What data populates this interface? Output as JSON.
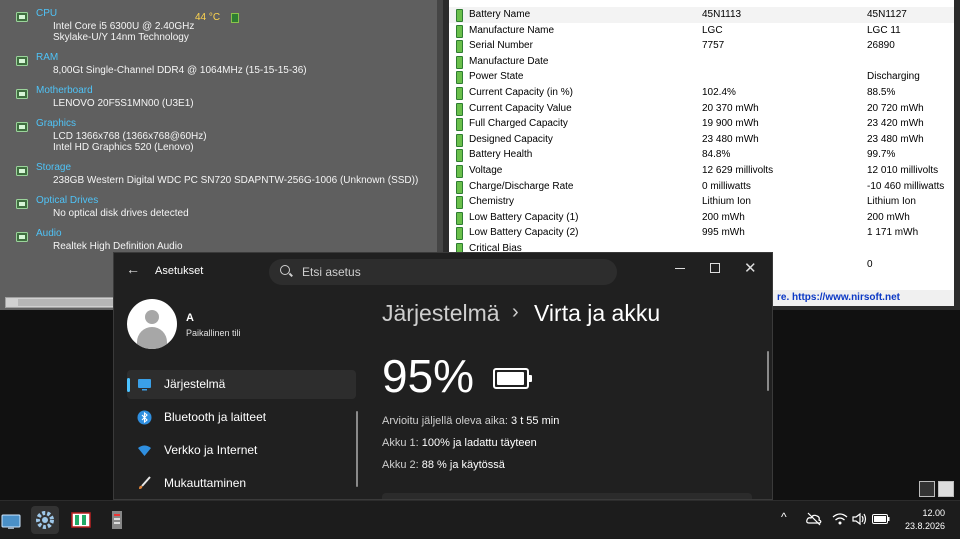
{
  "speccy": {
    "sections": [
      {
        "title": "CPU",
        "lines": [
          "Intel Core i5 6300U @ 2.40GHz",
          "Skylake-U/Y 14nm Technology"
        ],
        "icon": "cpu-icon"
      },
      {
        "title": "RAM",
        "lines": [
          "8,00Gt Single-Channel DDR4 @ 1064MHz (15-15-15-36)"
        ],
        "icon": "ram-icon"
      },
      {
        "title": "Motherboard",
        "lines": [
          "LENOVO 20F5S1MN00 (U3E1)"
        ],
        "icon": "motherboard-icon"
      },
      {
        "title": "Graphics",
        "lines": [
          "LCD 1366x768 (1366x768@60Hz)",
          "Intel HD Graphics 520 (Lenovo)"
        ],
        "icon": "monitor-icon"
      },
      {
        "title": "Storage",
        "lines": [
          "238GB Western Digital WDC PC SN720 SDAPNTW-256G-1006 (Unknown (SSD))"
        ],
        "icon": "hdd-icon"
      },
      {
        "title": "Optical Drives",
        "lines": [
          "No optical disk drives detected"
        ],
        "icon": "disc-icon"
      },
      {
        "title": "Audio",
        "lines": [
          "Realtek High Definition Audio"
        ],
        "icon": "audio-icon"
      }
    ],
    "cpu_temp": "44 °C"
  },
  "battery_view": {
    "rows": [
      {
        "name": "Battery Name",
        "b1": "45N1113",
        "b2": "45N1127"
      },
      {
        "name": "Manufacture Name",
        "b1": "LGC",
        "b2": "LGC 11"
      },
      {
        "name": "Serial Number",
        "b1": " 7757",
        "b2": "26890"
      },
      {
        "name": "Manufacture Date",
        "b1": "",
        "b2": ""
      },
      {
        "name": "Power State",
        "b1": "",
        "b2": "Discharging"
      },
      {
        "name": "Current Capacity (in %)",
        "b1": "102.4%",
        "b2": "88.5%"
      },
      {
        "name": "Current Capacity Value",
        "b1": "20 370 mWh",
        "b2": "20 720 mWh"
      },
      {
        "name": "Full Charged Capacity",
        "b1": "19 900 mWh",
        "b2": "23 420 mWh"
      },
      {
        "name": "Designed Capacity",
        "b1": "23 480 mWh",
        "b2": "23 480 mWh"
      },
      {
        "name": "Battery Health",
        "b1": "84.8%",
        "b2": "99.7%"
      },
      {
        "name": "Voltage",
        "b1": "12 629 millivolts",
        "b2": "12 010 millivolts"
      },
      {
        "name": "Charge/Discharge Rate",
        "b1": "0 milliwatts",
        "b2": "-10 460 milliwatts"
      },
      {
        "name": "Chemistry",
        "b1": "Lithium Ion",
        "b2": "Lithium Ion"
      },
      {
        "name": "Low Battery Capacity (1)",
        "b1": "200 mWh",
        "b2": "200 mWh"
      },
      {
        "name": "Low Battery Capacity (2)",
        "b1": "995 mWh",
        "b2": "1 171 mWh"
      },
      {
        "name": "Critical Bias",
        "b1": "",
        "b2": ""
      },
      {
        "name": "",
        "b1": "",
        "b2": "0"
      }
    ],
    "status_link": "re. https://www.nirsoft.net"
  },
  "settings": {
    "app_title": "Asetukset",
    "search_placeholder": "Etsi asetus",
    "close_glyph": "✕",
    "back_glyph": "←",
    "user_name": "A",
    "user_sub": "Paikallinen tili",
    "nav": [
      {
        "label": "Järjestelmä",
        "icon": "system-icon",
        "active": true
      },
      {
        "label": "Bluetooth ja laitteet",
        "icon": "bluetooth-icon",
        "active": false
      },
      {
        "label": "Verkko ja Internet",
        "icon": "wifi-icon",
        "active": false
      },
      {
        "label": "Mukauttaminen",
        "icon": "brush-icon",
        "active": false
      }
    ],
    "breadcrumb_parent": "Järjestelmä",
    "breadcrumb_sep": "›",
    "breadcrumb_current": "Virta ja akku",
    "battery_percent": "95%",
    "battery_level": 0.95,
    "remaining_label": "Arvioitu jäljellä oleva aika:",
    "remaining_value": "3 t 55 min",
    "battery1_label": "Akku 1:",
    "battery1_value": "100% ja ladattu täyteen",
    "battery2_label": "Akku 2:",
    "battery2_value": "88 % ja käytössä"
  },
  "taskbar": {
    "time": "12.00",
    "date": "23.8.2026",
    "tray_chevron": "^"
  },
  "colors": {
    "accent": "#4cc2ff",
    "link": "#0b38c5",
    "speccy_title": "#4fc3f7"
  }
}
